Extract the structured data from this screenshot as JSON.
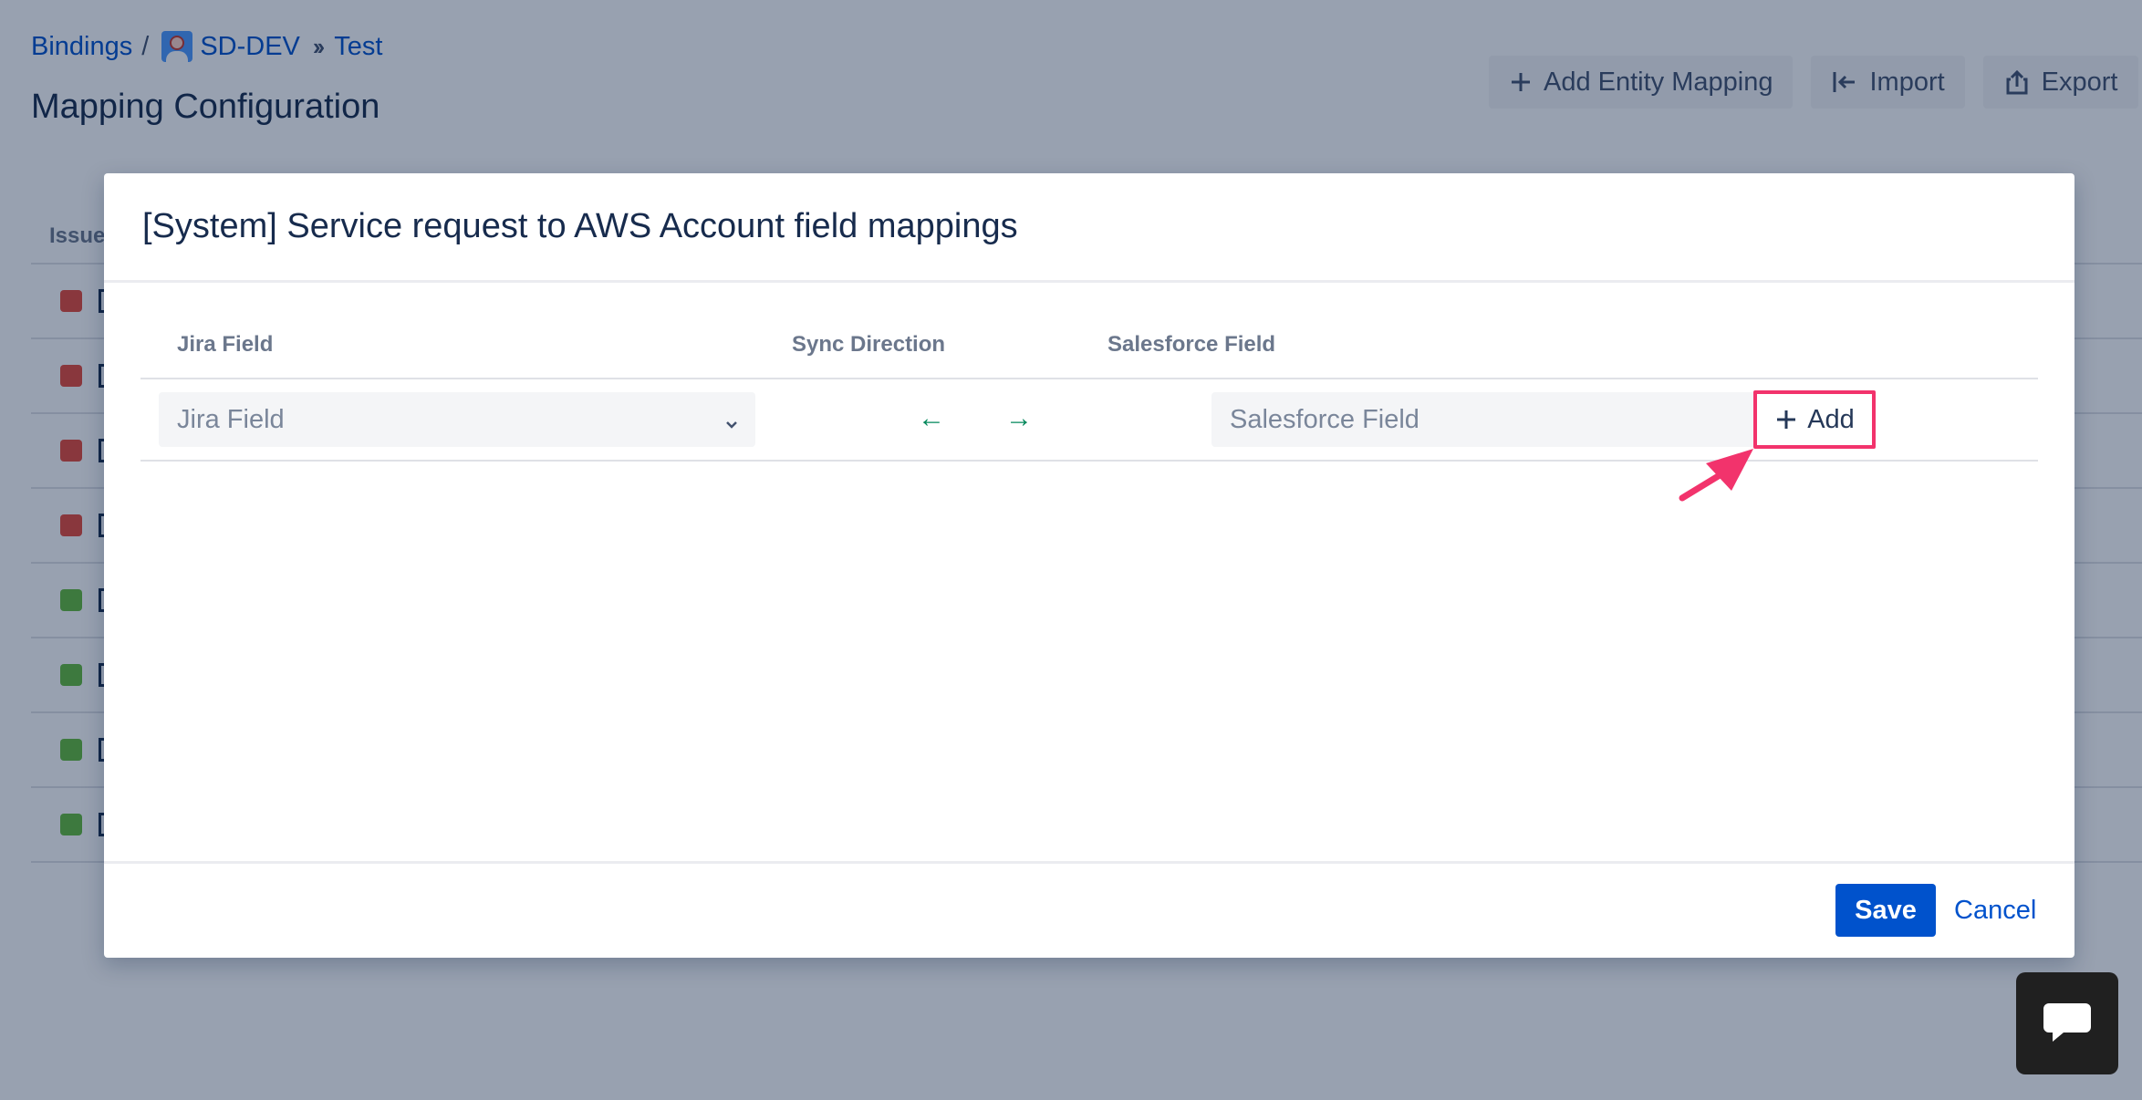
{
  "breadcrumb": {
    "root": "Bindings",
    "separator": "/",
    "project": "SD-DEV",
    "current": "Test"
  },
  "page": {
    "title": "Mapping Configuration"
  },
  "actions": {
    "add_entity_mapping": "Add Entity Mapping",
    "import": "Import",
    "export": "Export"
  },
  "background_table": {
    "header": "Issue",
    "rows": [
      "red",
      "red",
      "red",
      "red",
      "green",
      "green",
      "green",
      "green"
    ]
  },
  "modal": {
    "title": "[System] Service request to AWS Account field mappings",
    "columns": {
      "jira_field": "Jira Field",
      "sync_direction": "Sync Direction",
      "salesforce_field": "Salesforce Field"
    },
    "row": {
      "jira_placeholder": "Jira Field",
      "left_arrow": "←",
      "right_arrow": "→",
      "salesforce_placeholder": "Salesforce Field",
      "add_label": "Add"
    },
    "footer": {
      "save_label": "Save",
      "cancel_label": "Cancel"
    }
  },
  "colors": {
    "primary": "#0052cc",
    "highlight": "#f2336c",
    "sync_arrow": "#00875a",
    "overlay": "rgba(9,30,66,0.42)"
  },
  "icons": {
    "plus": "plus-icon",
    "import": "import-icon",
    "export": "export-icon",
    "chevron": "chevron-down-icon",
    "chat": "chat-icon",
    "annotation_arrow": "pointer-arrow-icon"
  }
}
